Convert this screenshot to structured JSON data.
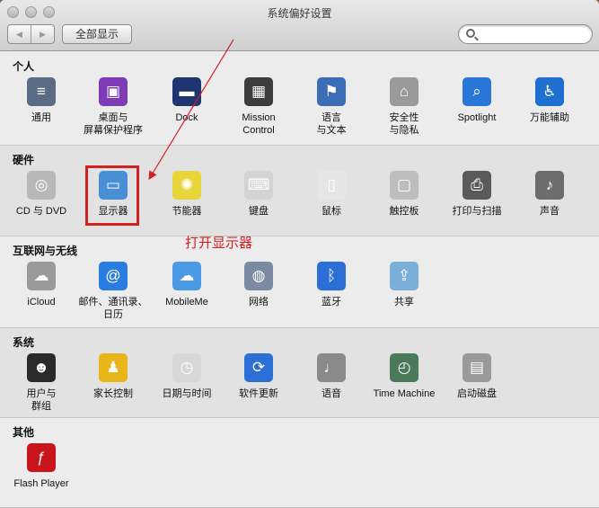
{
  "window": {
    "title": "系统偏好设置"
  },
  "toolbar": {
    "back": "◀",
    "forward": "▶",
    "show_all": "全部显示",
    "search_placeholder": ""
  },
  "sections": [
    {
      "title": "个人",
      "items": [
        {
          "label": "通用",
          "icon": "general-icon",
          "color": "#5b6b86"
        },
        {
          "label": "桌面与\n屏幕保护程序",
          "icon": "desktop-icon",
          "color": "#7d3bb5"
        },
        {
          "label": "Dock",
          "icon": "dock-icon",
          "color": "#1e3570"
        },
        {
          "label": "Mission\nControl",
          "icon": "mission-control-icon",
          "color": "#3c3c3c"
        },
        {
          "label": "语言\n与文本",
          "icon": "language-icon",
          "color": "#3a6db5"
        },
        {
          "label": "安全性\n与隐私",
          "icon": "security-icon",
          "color": "#9a9a9a"
        },
        {
          "label": "Spotlight",
          "icon": "spotlight-icon",
          "color": "#2a76d8"
        },
        {
          "label": "万能辅助",
          "icon": "accessibility-icon",
          "color": "#1f6fd0"
        }
      ]
    },
    {
      "title": "硬件",
      "items": [
        {
          "label": "CD 与 DVD",
          "icon": "cd-dvd-icon",
          "color": "#b8b8b8"
        },
        {
          "label": "显示器",
          "icon": "display-icon",
          "color": "#4a8fd6"
        },
        {
          "label": "节能器",
          "icon": "bulb-icon",
          "color": "#e8d53a"
        },
        {
          "label": "键盘",
          "icon": "keyboard-icon",
          "color": "#d4d4d4"
        },
        {
          "label": "鼠标",
          "icon": "mouse-icon",
          "color": "#e6e6e6"
        },
        {
          "label": "触控板",
          "icon": "trackpad-icon",
          "color": "#bdbdbd"
        },
        {
          "label": "打印与扫描",
          "icon": "printer-icon",
          "color": "#5a5a5a"
        },
        {
          "label": "声音",
          "icon": "speaker-icon",
          "color": "#6d6d6d"
        }
      ]
    },
    {
      "title": "互联网与无线",
      "items": [
        {
          "label": "iCloud",
          "icon": "icloud-icon",
          "color": "#9a9a9a"
        },
        {
          "label": "邮件、通讯录、\n日历",
          "icon": "at-icon",
          "color": "#2a7de0"
        },
        {
          "label": "MobileMe",
          "icon": "mobileme-icon",
          "color": "#4a9ae6"
        },
        {
          "label": "网络",
          "icon": "network-icon",
          "color": "#7a8aa0"
        },
        {
          "label": "蓝牙",
          "icon": "bluetooth-icon",
          "color": "#2a6ed6"
        },
        {
          "label": "共享",
          "icon": "sharing-icon",
          "color": "#7ab0d8"
        }
      ]
    },
    {
      "title": "系统",
      "items": [
        {
          "label": "用户与\n群组",
          "icon": "users-icon",
          "color": "#2a2a2a"
        },
        {
          "label": "家长控制",
          "icon": "parental-icon",
          "color": "#e8b51a"
        },
        {
          "label": "日期与时间",
          "icon": "clock-icon",
          "color": "#d8d8d8"
        },
        {
          "label": "软件更新",
          "icon": "update-icon",
          "color": "#2a6ed6"
        },
        {
          "label": "语音",
          "icon": "microphone-icon",
          "color": "#8a8a8a"
        },
        {
          "label": "Time Machine",
          "icon": "time-machine-icon",
          "color": "#4a7a5a"
        },
        {
          "label": "启动磁盘",
          "icon": "disk-icon",
          "color": "#9a9a9a"
        }
      ]
    },
    {
      "title": "其他",
      "items": [
        {
          "label": "Flash Player",
          "icon": "flash-icon",
          "color": "#c8141a"
        }
      ]
    }
  ],
  "annotation": {
    "text": "打开显示器",
    "color": "#d21f1f"
  }
}
